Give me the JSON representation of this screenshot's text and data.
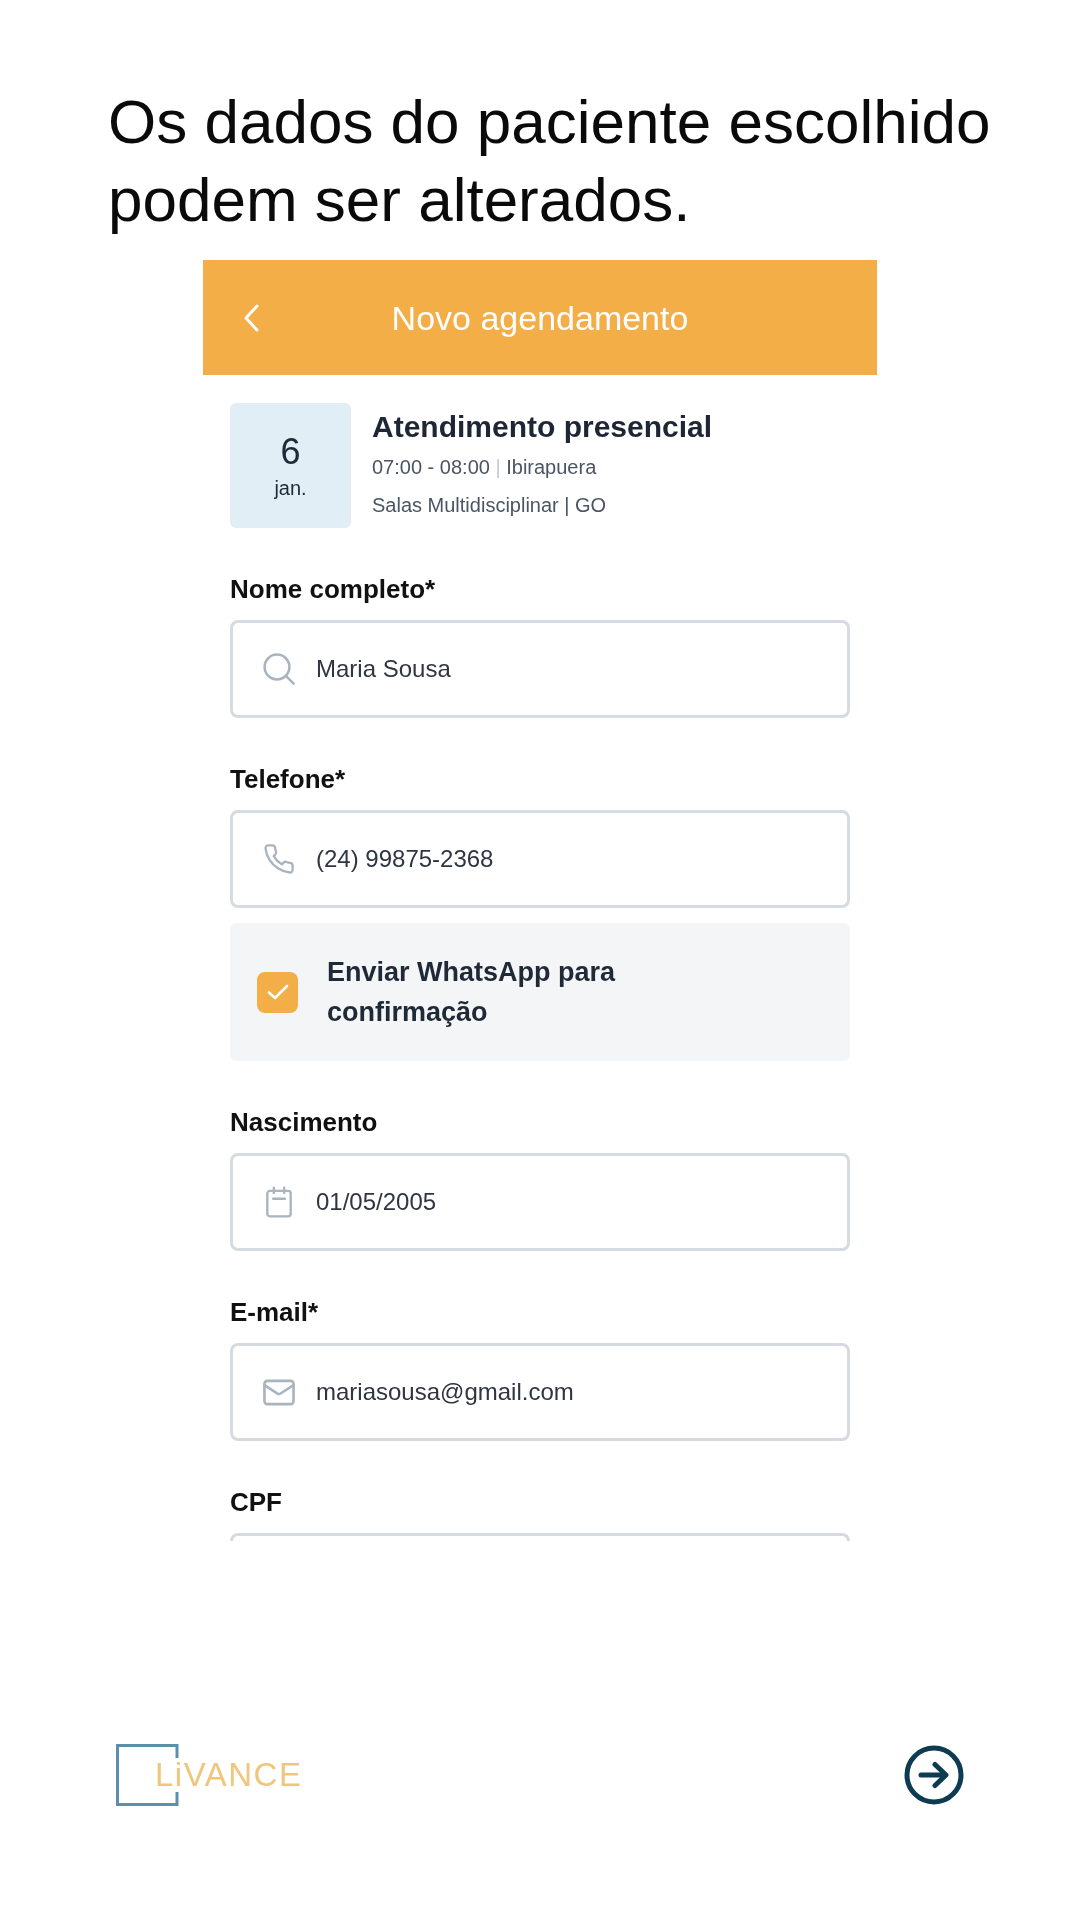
{
  "caption": "Os dados do paciente escolhido podem ser alterados.",
  "header": {
    "title": "Novo agendamento"
  },
  "appointment": {
    "day": "6",
    "month": "jan.",
    "title": "Atendimento presencial",
    "time": "07:00 - 08:00",
    "separator": "|",
    "place": "Ibirapuera",
    "room": "Salas Multidisciplinar | GO"
  },
  "form": [
    {
      "kind": "search",
      "label": "Nome completo*",
      "value": "Maria Sousa"
    },
    {
      "kind": "phone",
      "label": "Telefone*",
      "value": "(24) 99875-2368"
    },
    {
      "kind": "checkbox",
      "label": "Enviar WhatsApp para confirmação",
      "checked": true
    },
    {
      "kind": "date",
      "label": "Nascimento",
      "value": "01/05/2005"
    },
    {
      "kind": "email",
      "label": "E-mail*",
      "value": "mariasousa@gmail.com"
    },
    {
      "kind": "cropped",
      "label": "CPF"
    }
  ],
  "footer": {
    "logo": "LiVANCE"
  }
}
